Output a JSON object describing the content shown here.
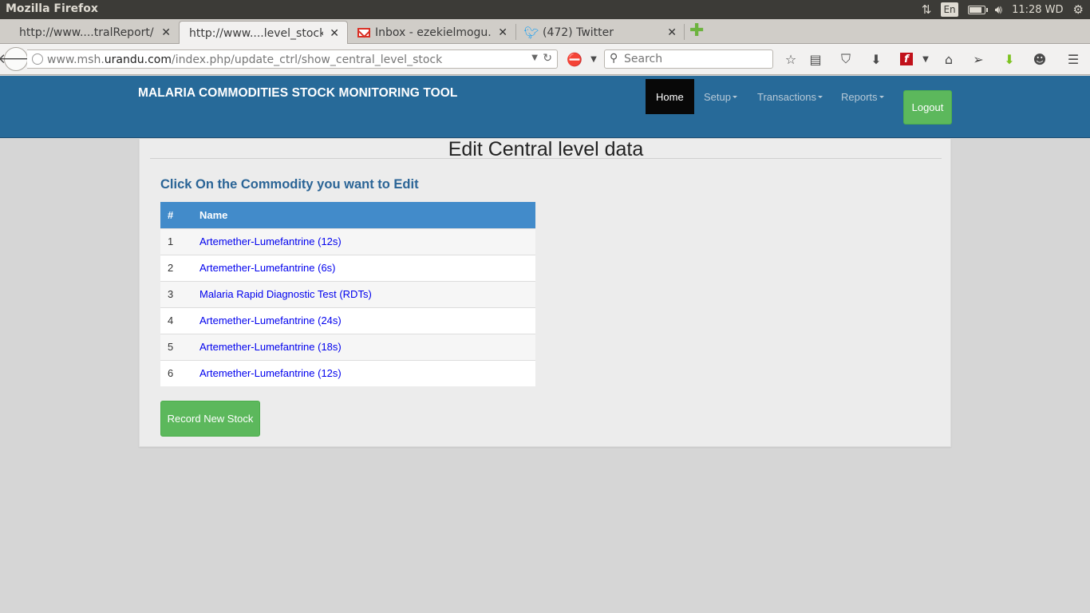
{
  "os": {
    "window_title": "Mozilla Firefox",
    "keyboard_layout": "En",
    "battery_level": 0.75,
    "clock": "11:28 WD",
    "icons": [
      "network-arrows-icon",
      "battery-icon",
      "volume-icon",
      "settings-gear-icon"
    ]
  },
  "browser": {
    "tabs": [
      {
        "label": "http://www....tralReport/",
        "active": false,
        "favicon": "none"
      },
      {
        "label": "http://www....level_stock",
        "active": true,
        "favicon": "none"
      },
      {
        "label": "Inbox - ezekielmogu...",
        "active": false,
        "favicon": "gmail-icon"
      },
      {
        "label": "(472) Twitter",
        "active": false,
        "favicon": "twitter-icon"
      }
    ],
    "url": {
      "prefix": "www.msh.",
      "domain": "urandu.com",
      "path": "/index.php/update_ctrl/show_central_level_stock"
    },
    "search_placeholder": "Search"
  },
  "app": {
    "brand": "MALARIA COMMODITIES STOCK MONITORING TOOL",
    "nav": {
      "home": "Home",
      "setup": "Setup",
      "transactions": "Transactions",
      "reports": "Reports",
      "logout": "Logout"
    },
    "accent": "#276a99",
    "success": "#5cb85c"
  },
  "main": {
    "title": "Edit Central level data",
    "subtitle": "Click On the Commodity you want to Edit",
    "table": {
      "headers": [
        "#",
        "Name"
      ],
      "rows": [
        {
          "num": "1",
          "name": "Artemether-Lumefantrine (12s)"
        },
        {
          "num": "2",
          "name": "Artemether-Lumefantrine (6s)"
        },
        {
          "num": "3",
          "name": "Malaria Rapid Diagnostic Test (RDTs)"
        },
        {
          "num": "4",
          "name": "Artemether-Lumefantrine (24s)"
        },
        {
          "num": "5",
          "name": "Artemether-Lumefantrine (18s)"
        },
        {
          "num": "6",
          "name": "Artemether-Lumefantrine (12s)"
        }
      ]
    },
    "record_button": "Record New Stock"
  }
}
